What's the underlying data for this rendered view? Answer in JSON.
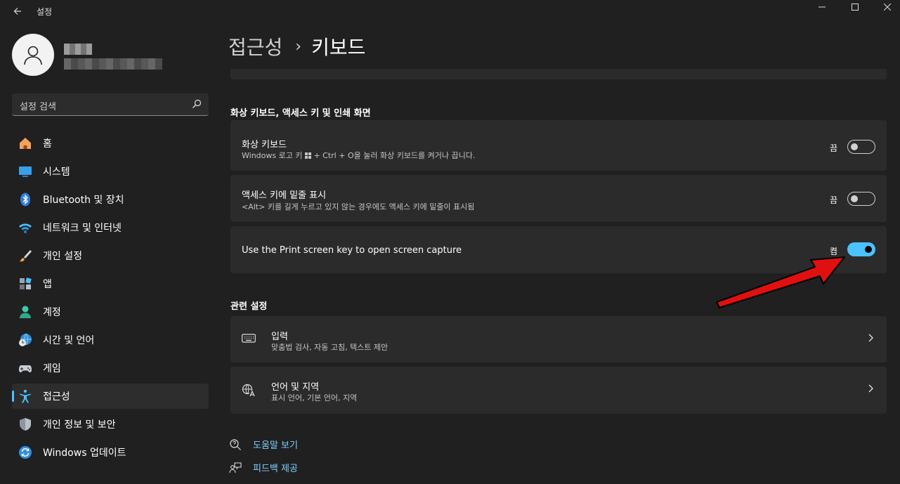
{
  "window": {
    "title": "설정"
  },
  "user": {
    "name": "",
    "email": ""
  },
  "search": {
    "placeholder": "설정 검색"
  },
  "sidebar": {
    "items": [
      {
        "label": "홈",
        "icon": "home-icon"
      },
      {
        "label": "시스템",
        "icon": "system-icon"
      },
      {
        "label": "Bluetooth 및 장치",
        "icon": "bluetooth-icon"
      },
      {
        "label": "네트워크 및 인터넷",
        "icon": "wifi-icon"
      },
      {
        "label": "개인 설정",
        "icon": "brush-icon"
      },
      {
        "label": "앱",
        "icon": "apps-icon"
      },
      {
        "label": "계정",
        "icon": "account-icon"
      },
      {
        "label": "시간 및 언어",
        "icon": "time-language-icon"
      },
      {
        "label": "게임",
        "icon": "gamepad-icon"
      },
      {
        "label": "접근성",
        "icon": "accessibility-icon",
        "active": true
      },
      {
        "label": "개인 정보 및 보안",
        "icon": "shield-icon"
      },
      {
        "label": "Windows 업데이트",
        "icon": "update-icon"
      }
    ]
  },
  "header": {
    "crumb_parent": "접근성",
    "separator": "›",
    "crumb_current": "키보드"
  },
  "section_keyboard": {
    "title": "화상 키보드, 액세스 키 및 인쇄 화면",
    "items": [
      {
        "title": "화상 키보드",
        "desc_before": "Windows 로고 키 ",
        "desc_after": " + Ctrl + O을 눌러 화상 키보드를 켜거나 끕니다.",
        "state": "끔",
        "on": false
      },
      {
        "title": "액세스 키에 밑줄 표시",
        "desc": "<Alt> 키를 길게 누르고 있지 않는 경우에도 액세스 키에 밑줄이 표시됨",
        "state": "끔",
        "on": false
      },
      {
        "title": "Use the Print screen key to open screen capture",
        "state": "켬",
        "on": true
      }
    ]
  },
  "section_related": {
    "title": "관련 설정",
    "items": [
      {
        "title": "입력",
        "desc": "맞춤법 검사, 자동 고침, 텍스트 제안",
        "icon": "keyboard-icon"
      },
      {
        "title": "언어 및 지역",
        "desc": "표시 언어, 기본 언어, 지역",
        "icon": "language-region-icon"
      }
    ]
  },
  "footer_links": [
    {
      "label": "도움말 보기",
      "icon": "help-icon"
    },
    {
      "label": "피드백 제공",
      "icon": "feedback-icon"
    }
  ],
  "colors": {
    "accent": "#4cc2ff",
    "background": "#202020",
    "card": "#2b2b2b",
    "annotation_arrow": "#e01010"
  }
}
